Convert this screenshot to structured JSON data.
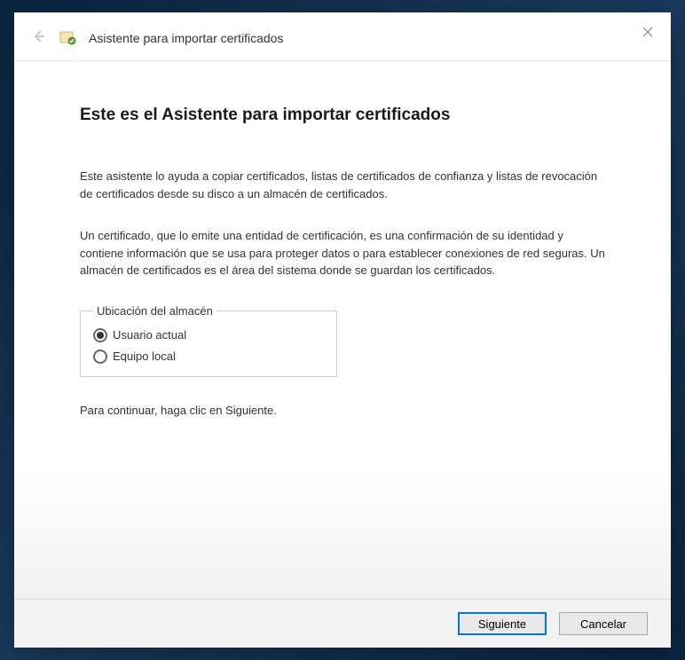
{
  "header": {
    "title": "Asistente para importar certificados"
  },
  "content": {
    "main_title": "Este es el Asistente para importar certificados",
    "paragraph1": "Este asistente lo ayuda a copiar certificados, listas de certificados de confianza y listas de revocación de certificados desde su disco a un almacén de certificados.",
    "paragraph2": "Un certificado, que lo emite una entidad de certificación, es una confirmación de su identidad y contiene información que se usa para proteger datos o para establecer conexiones de red seguras. Un almacén de certificados es el área del sistema donde se guardan los certificados.",
    "fieldset_legend": "Ubicación del almacén",
    "radio_options": [
      {
        "label": "Usuario actual",
        "selected": true
      },
      {
        "label": "Equipo local",
        "selected": false
      }
    ],
    "continue_text": "Para continuar, haga clic en Siguiente."
  },
  "footer": {
    "next_label": "Siguiente",
    "cancel_label": "Cancelar"
  }
}
